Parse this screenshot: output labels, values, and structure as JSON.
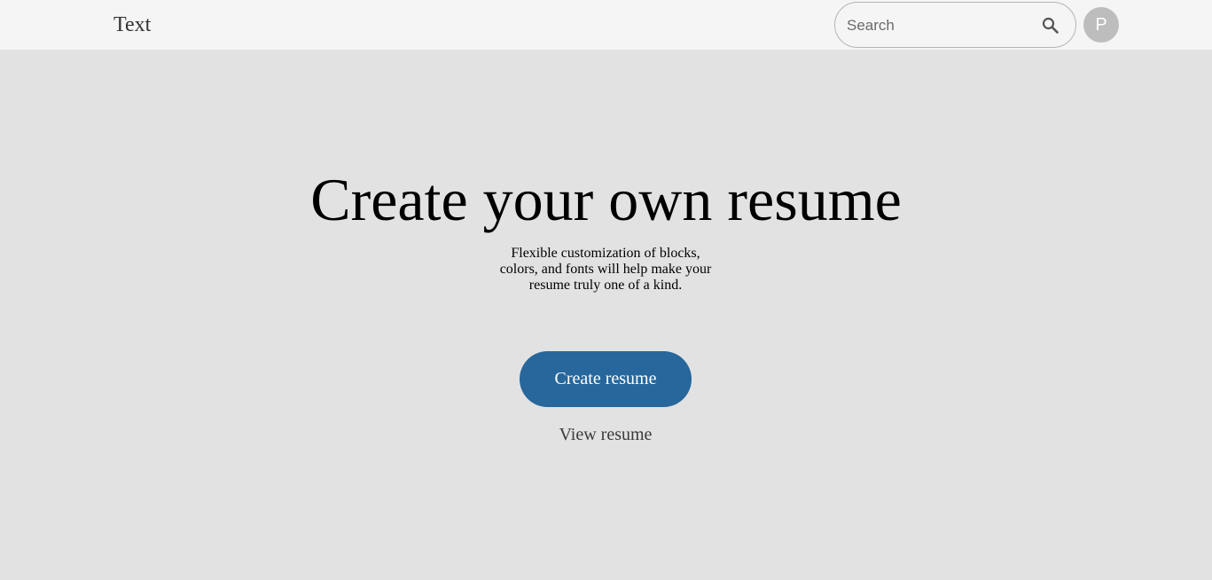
{
  "header": {
    "logo_text": "Text",
    "search": {
      "placeholder": "Search",
      "value": "",
      "icon": "search-icon"
    },
    "avatar_letter": "P"
  },
  "hero": {
    "title": "Create your own resume",
    "subtitle": "Flexible customization of blocks, colors, and fonts will help make your resume truly one of a kind.",
    "primary_button_label": "Create resume",
    "secondary_link_label": "View resume"
  },
  "colors": {
    "header_background": "#f5f5f5",
    "page_background": "#e2e2e2",
    "accent": "#27679b",
    "avatar_background": "#bdbdbd"
  }
}
